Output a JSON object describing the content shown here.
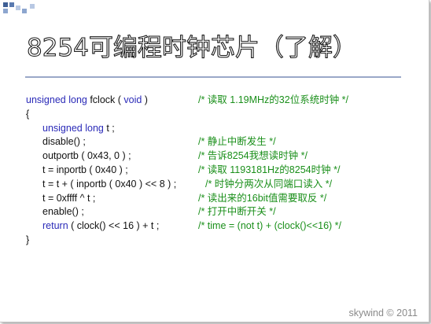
{
  "slide": {
    "title": "8254可编程时钟芯片（了解）",
    "watermark": "skywind © 2011",
    "colors": {
      "keyword": "#2a2ab8",
      "comment": "#1a8f1a",
      "text": "#111111",
      "divider": "#9aa8c8",
      "deco_squares": [
        "#3f5f95",
        "#5a7ab0",
        "#8da6cf",
        "#b8c8e3"
      ]
    }
  },
  "code": {
    "lines": [
      {
        "segs": [
          {
            "t": "unsigned long ",
            "kw": true
          },
          {
            "t": "fclock ( "
          },
          {
            "t": "void",
            "kw": true
          },
          {
            "t": " )"
          }
        ],
        "comment": "/* 读取 1.19MHz的32位系统时钟 */"
      },
      {
        "segs": [
          {
            "t": "{"
          }
        ],
        "comment": ""
      },
      {
        "segs": [
          {
            "t": "unsigned long ",
            "kw": true
          },
          {
            "t": "t ;"
          }
        ],
        "comment": ""
      },
      {
        "segs": [
          {
            "t": "disable() ;"
          }
        ],
        "comment": "/* 静止中断发生 */"
      },
      {
        "segs": [
          {
            "t": "outportb ( 0x43, 0 ) ;"
          }
        ],
        "comment": "/* 告诉8254我想读时钟 */"
      },
      {
        "segs": [
          {
            "t": "t = inportb ( 0x40 ) ;"
          }
        ],
        "comment": "/* 读取 1193181Hz的8254时钟 */"
      },
      {
        "segs": [
          {
            "t": "t = t + ( inportb ( 0x40 ) << 8 ) ;"
          }
        ],
        "comment": "/* 时钟分两次从同端口读入 */"
      },
      {
        "segs": [
          {
            "t": "t = 0xffff ^ t ;"
          }
        ],
        "comment": "/* 读出来的16bit值需要取反 */"
      },
      {
        "segs": [
          {
            "t": "enable() ;"
          }
        ],
        "comment": "/* 打开中断开关 */"
      },
      {
        "segs": [
          {
            "t": "return",
            "kw": true
          },
          {
            "t": " ( clock() << 16 ) + t ;"
          }
        ],
        "comment": "/* time = (not t) + (clock()<<16) */"
      },
      {
        "segs": [
          {
            "t": "}"
          }
        ],
        "comment": ""
      }
    ]
  }
}
